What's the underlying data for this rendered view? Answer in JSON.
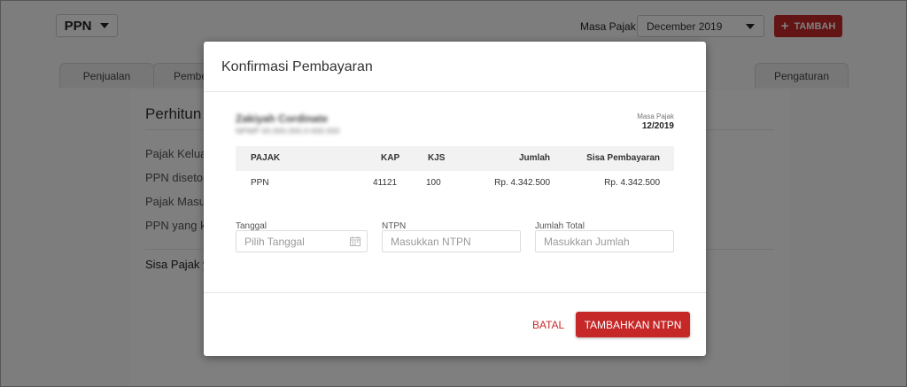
{
  "header": {
    "tax_type": "PPN",
    "masa_pajak_label": "Masa Pajak",
    "period_value": "December 2019",
    "add_button": "TAMBAH",
    "add_icon": "plus-icon",
    "dropdown_icon": "caret-down-icon"
  },
  "tabs": [
    {
      "label": "Penjualan"
    },
    {
      "label": "Pembe"
    },
    {
      "label": "Pengaturan"
    }
  ],
  "section": {
    "title": "Perhitun",
    "rows": [
      "Pajak Keluar",
      "PPN disetor",
      "Pajak Masuk",
      "PPN yang ku"
    ],
    "sisa": "Sisa Pajak ya"
  },
  "modal": {
    "title": "Konfirmasi Pembayaran",
    "company_name": "Zakiyah Cordinate",
    "company_sub": "NPWP 00.000.000.0-000.000",
    "masa_label": "Masa Pajak",
    "masa_value": "12/2019",
    "table": {
      "headers": [
        "PAJAK",
        "KAP",
        "KJS",
        "Jumlah",
        "Sisa Pembayaran"
      ],
      "rows": [
        [
          "PPN",
          "41121",
          "100",
          "Rp. 4.342.500",
          "Rp. 4.342.500"
        ]
      ]
    },
    "fields": {
      "tanggal_label": "Tanggal",
      "tanggal_placeholder": "Pilih Tanggal",
      "ntpn_label": "NTPN",
      "ntpn_placeholder": "Masukkan NTPN",
      "jumlah_label": "Jumlah Total",
      "jumlah_placeholder": "Masukkan Jumlah"
    },
    "cancel_button": "BATAL",
    "submit_button": "TAMBAHKAN NTPN",
    "accent_color": "#c62828"
  }
}
